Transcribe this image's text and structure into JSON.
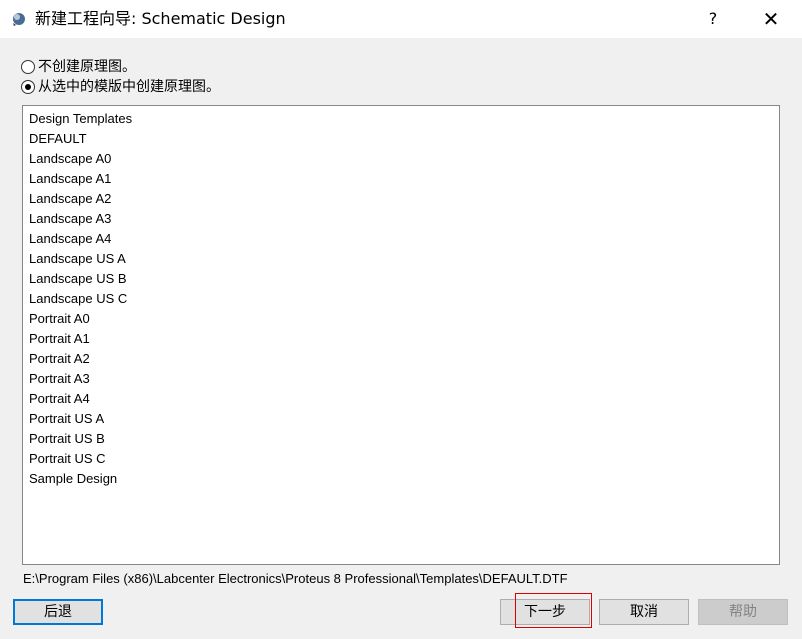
{
  "window": {
    "title": "新建工程向导: Schematic Design",
    "help_label": "?",
    "close_label": "✕"
  },
  "options": {
    "no_schematic": "不创建原理图。",
    "from_template": "从选中的模版中创建原理图。",
    "selected": "from_template"
  },
  "templates": [
    "Design Templates",
    "DEFAULT",
    "Landscape A0",
    "Landscape A1",
    "Landscape A2",
    "Landscape A3",
    "Landscape A4",
    "Landscape US A",
    "Landscape US B",
    "Landscape US C",
    "Portrait A0",
    "Portrait A1",
    "Portrait A2",
    "Portrait A3",
    "Portrait A4",
    "Portrait US A",
    "Portrait US B",
    "Portrait US C",
    "Sample Design"
  ],
  "path": "E:\\Program Files (x86)\\Labcenter Electronics\\Proteus 8 Professional\\Templates\\DEFAULT.DTF",
  "buttons": {
    "back": "后退",
    "next": "下一步",
    "cancel": "取消",
    "help": "帮助"
  }
}
